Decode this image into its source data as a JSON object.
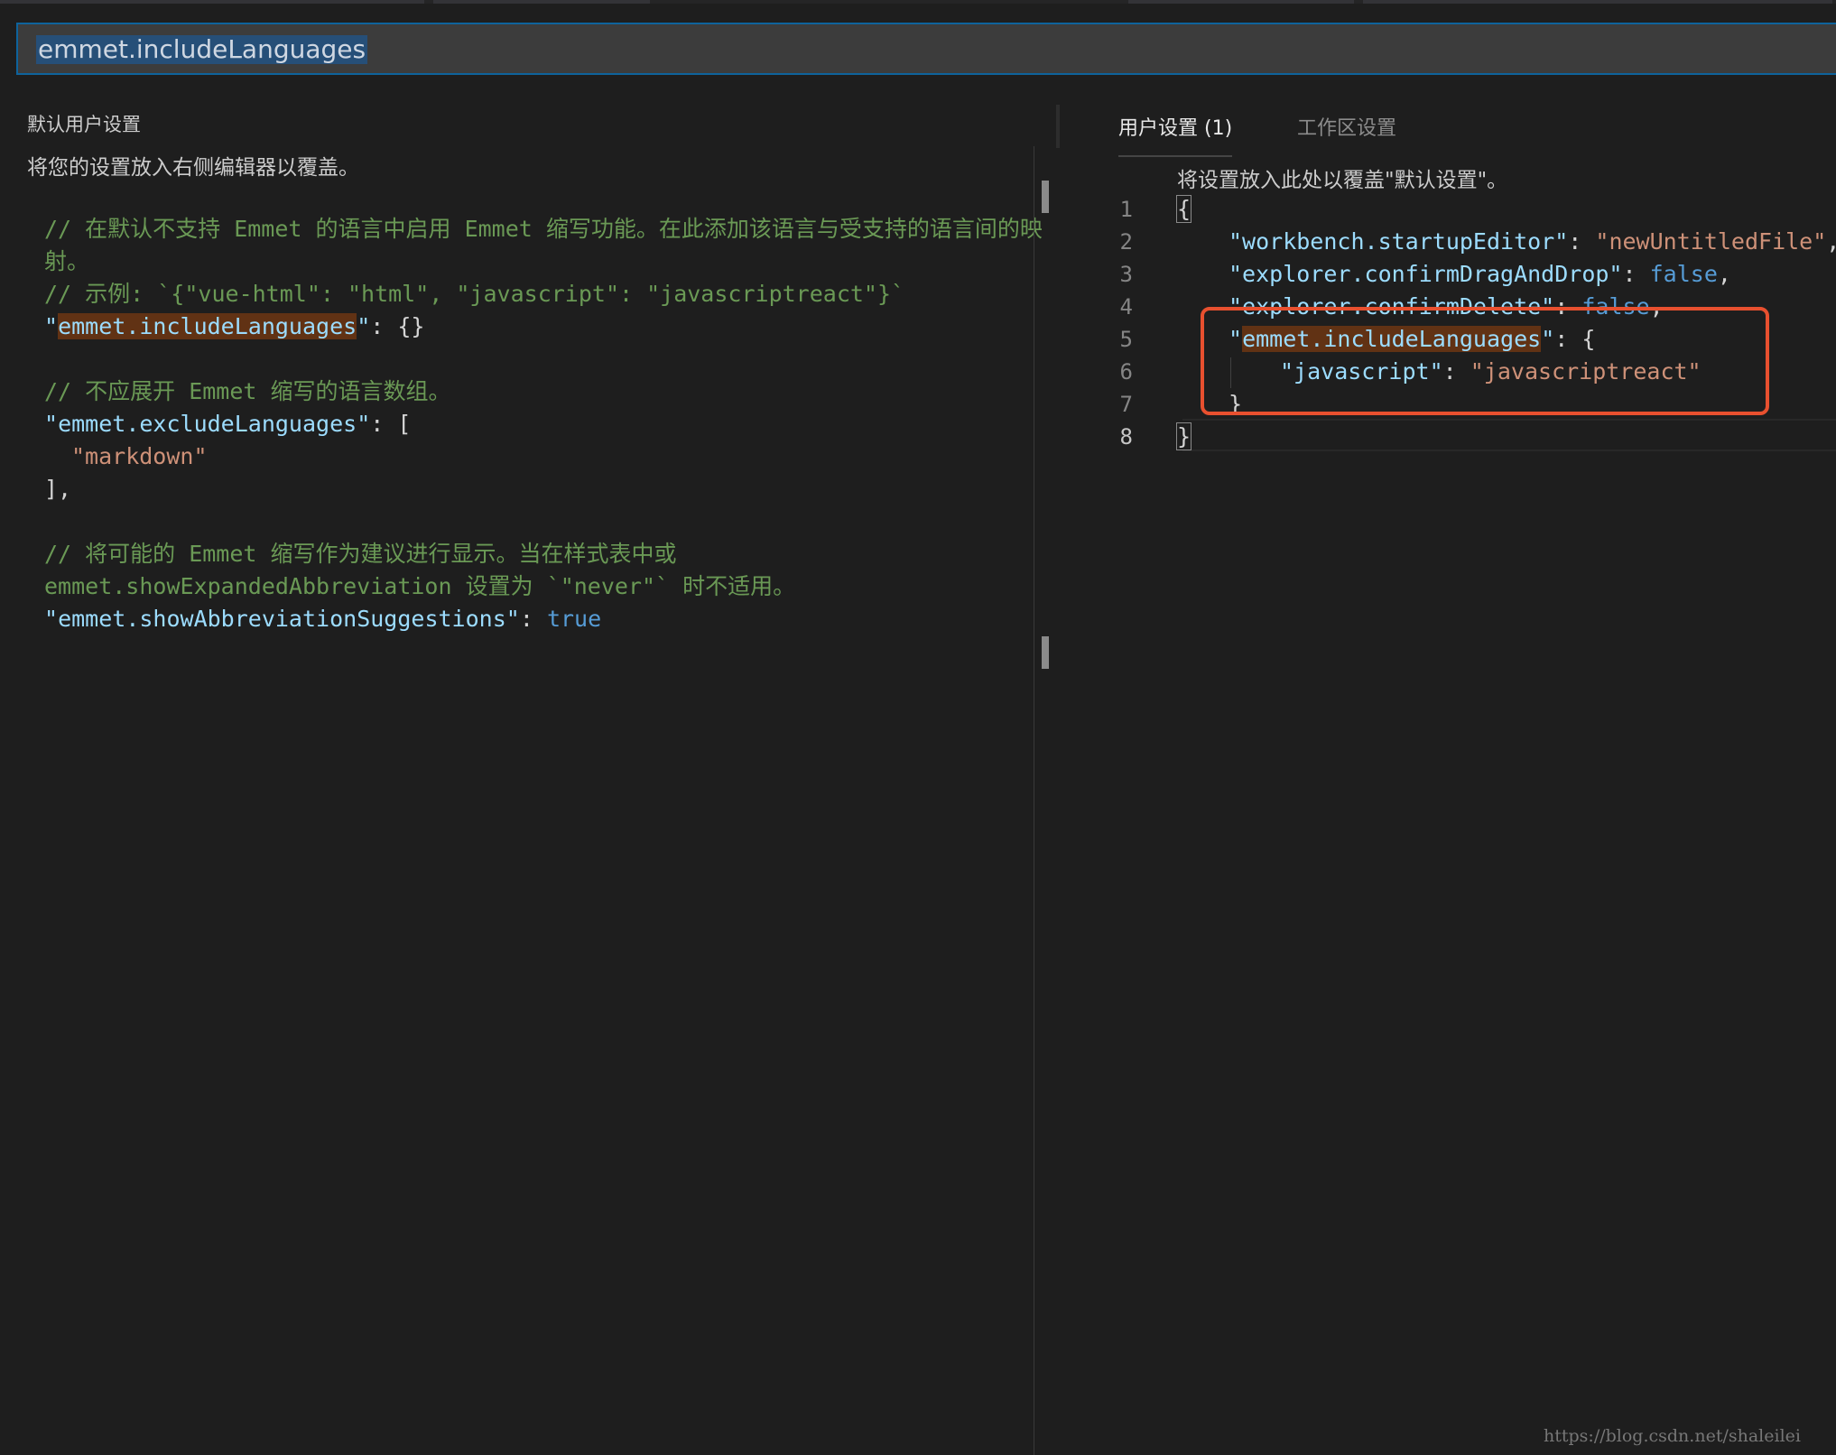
{
  "search": {
    "value": "emmet.includeLanguages"
  },
  "left_pane": {
    "title": "默认用户设置",
    "description": "将您的设置放入右侧编辑器以覆盖。",
    "code": {
      "c1_a": "// 在默认不支持 Emmet 的语言中启用 Emmet 缩写功能。在此添加该语言与受支持的语言间的映",
      "c1_b": "射。",
      "c2": "// 示例: `{\"vue-html\": \"html\", \"javascript\": \"javascriptreact\"}`",
      "k1": "emmet.includeLanguages",
      "v1": "{}",
      "c3": "// 不应展开 Emmet 缩写的语言数组。",
      "k2": "emmet.excludeLanguages",
      "v2_open": "[",
      "v2_item": "\"markdown\"",
      "v2_close": "],",
      "c4_a": "// 将可能的 Emmet 缩写作为建议进行显示。当在样式表中或",
      "c4_b": "emmet.showExpandedAbbreviation 设置为 `\"never\"` 时不适用。",
      "k3": "emmet.showAbbreviationSuggestions",
      "v3": "true"
    }
  },
  "right_pane": {
    "tabs": {
      "user": "用户设置 (1)",
      "workspace": "工作区设置"
    },
    "description": "将设置放入此处以覆盖\"默认设置\"。",
    "line_numbers": [
      "1",
      "2",
      "3",
      "4",
      "5",
      "6",
      "7",
      "8"
    ],
    "code": {
      "open": "{",
      "k1": "\"workbench.startupEditor\"",
      "v1": "\"newUntitledFile\"",
      "k2": "\"explorer.confirmDragAndDrop\"",
      "v2": "false",
      "k3": "\"explorer.confirmDelete\"",
      "v3": "false",
      "k4": "emmet.includeLanguages",
      "k5": "\"javascript\"",
      "v5": "\"javascriptreact\"",
      "inner_close": "}",
      "close": "}"
    }
  },
  "watermark": "https://blog.csdn.net/shaleilei",
  "colors": {
    "background": "#1e1e1e",
    "comment": "#6a9955",
    "key": "#9cdcfe",
    "string": "#ce9178",
    "keyword": "#569cd6",
    "highlight": "#613214",
    "annotation_box": "#e8502f"
  }
}
